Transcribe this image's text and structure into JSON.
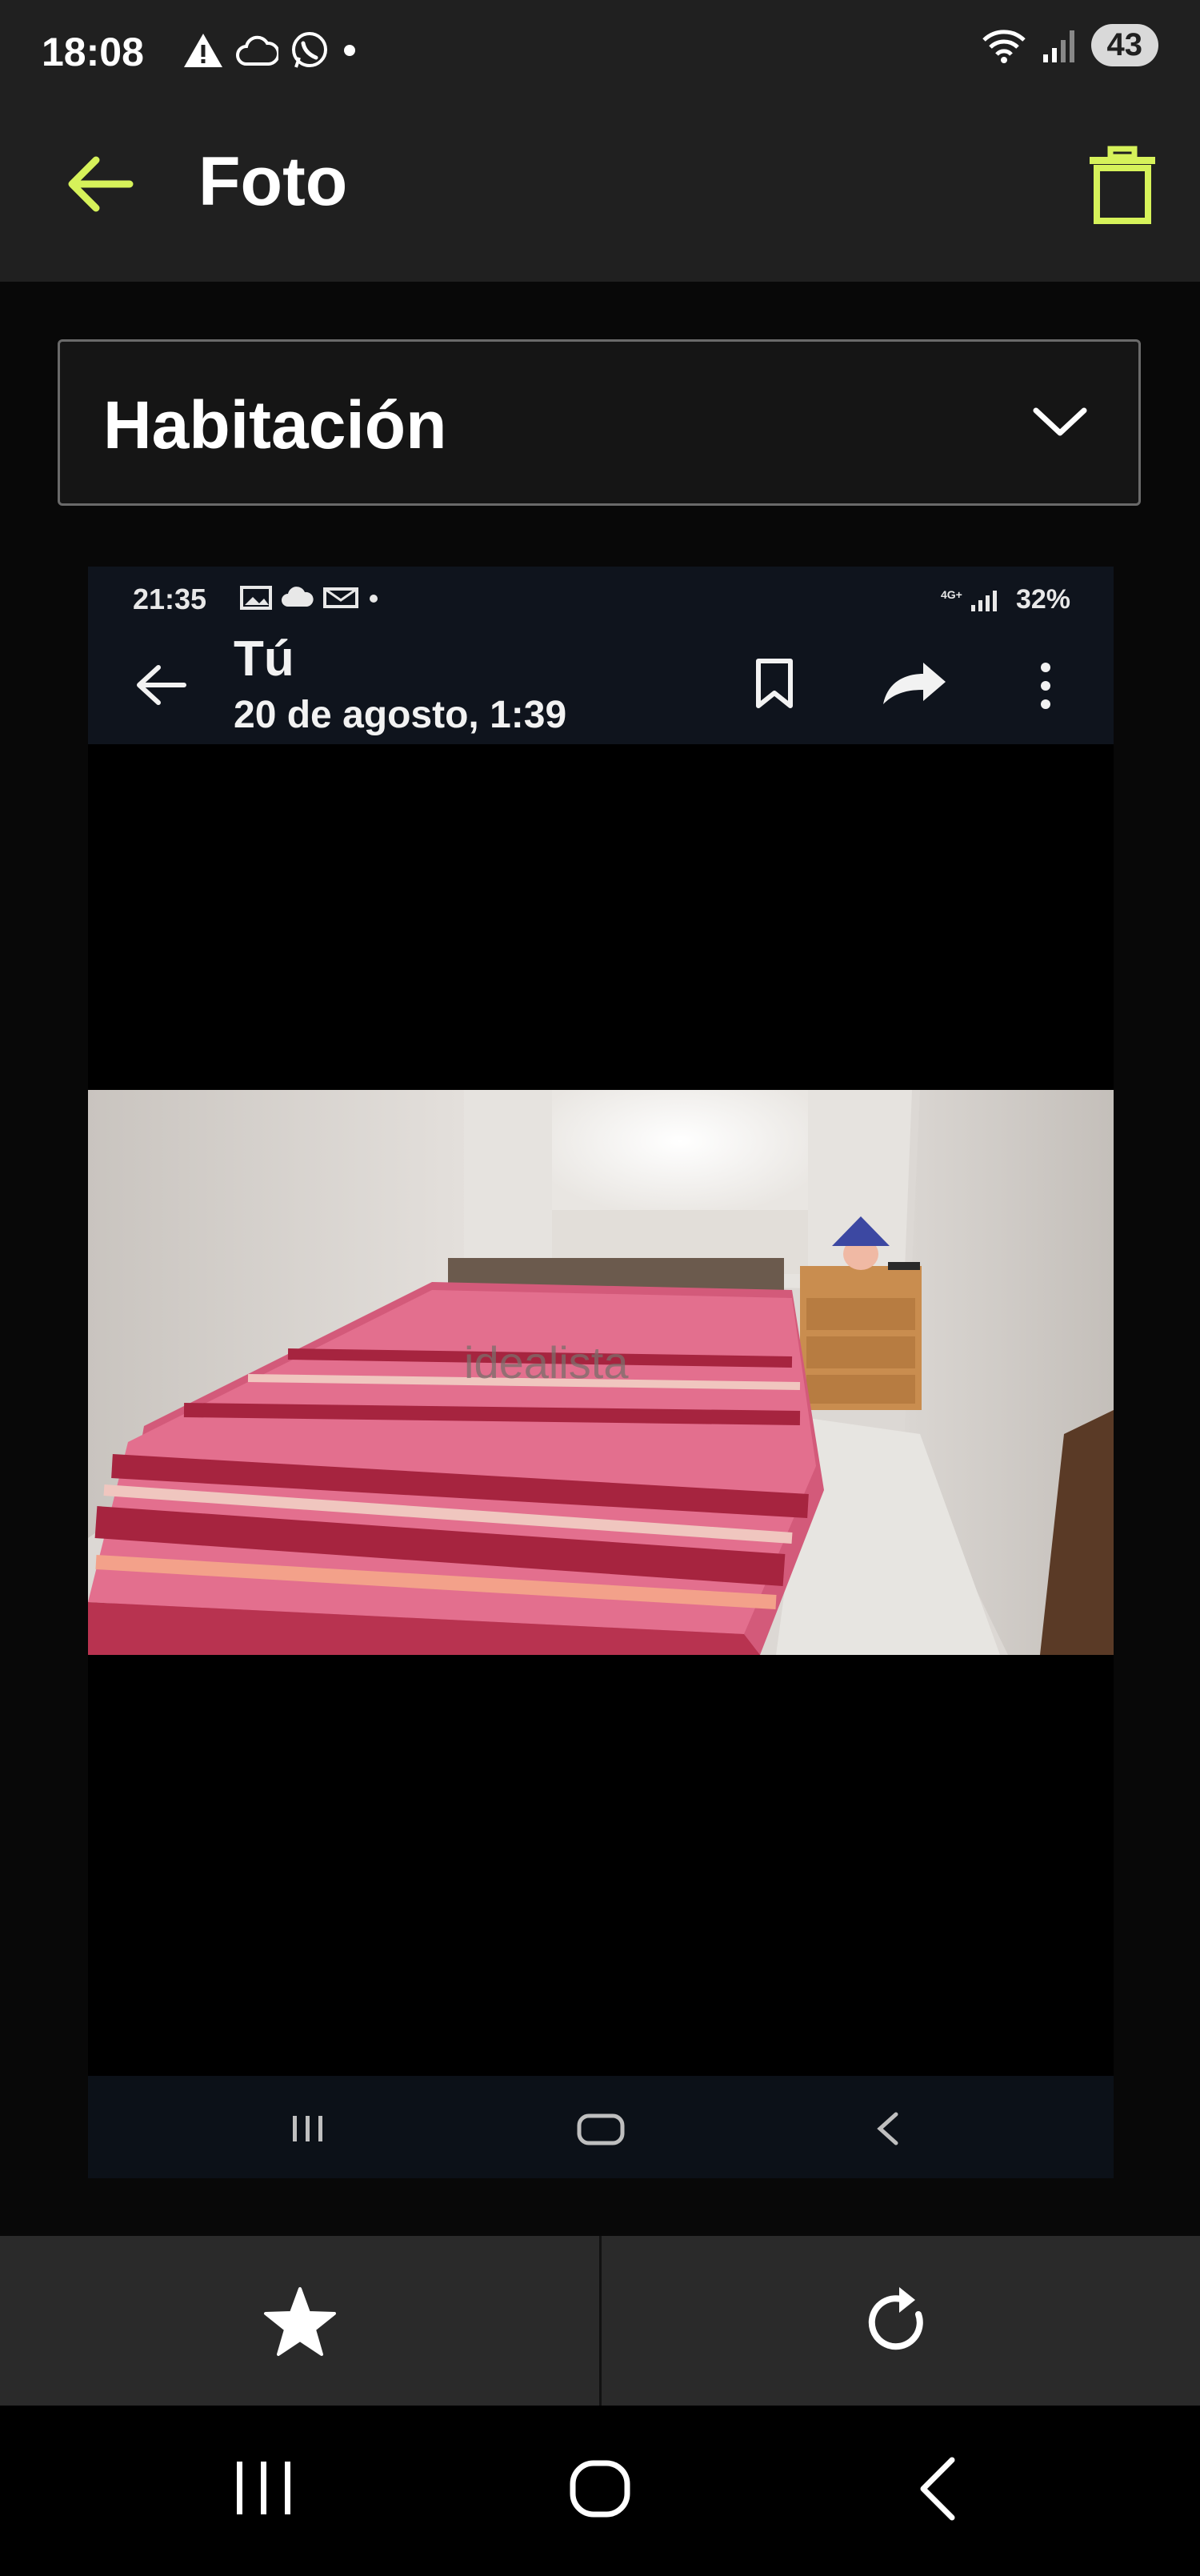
{
  "status_bar": {
    "time": "18:08",
    "battery": "43",
    "icons_left": [
      "warning-icon",
      "cloud-icon",
      "whatsapp-icon",
      "dot-icon"
    ],
    "icons_right": [
      "wifi-icon",
      "signal-icon"
    ]
  },
  "app_bar": {
    "title": "Foto",
    "back_icon": "arrow-left-icon",
    "delete_icon": "trash-icon",
    "accent_color": "#d6f25a"
  },
  "category_select": {
    "selected": "Habitación"
  },
  "embedded_screenshot": {
    "status_time": "21:35",
    "status_right": "32%",
    "sender": "Tú",
    "date": "20 de agosto, 1:39",
    "watermark": "idealista",
    "icons": [
      "arrow-left-icon",
      "bookmark-icon",
      "share-icon",
      "more-vert-icon"
    ],
    "nav_icons": [
      "recents-icon",
      "home-icon",
      "back-icon"
    ]
  },
  "action_bar": {
    "favorite_icon": "star-icon",
    "rotate_icon": "rotate-icon"
  },
  "system_nav": {
    "icons": [
      "recents-icon",
      "home-icon",
      "back-icon"
    ]
  }
}
